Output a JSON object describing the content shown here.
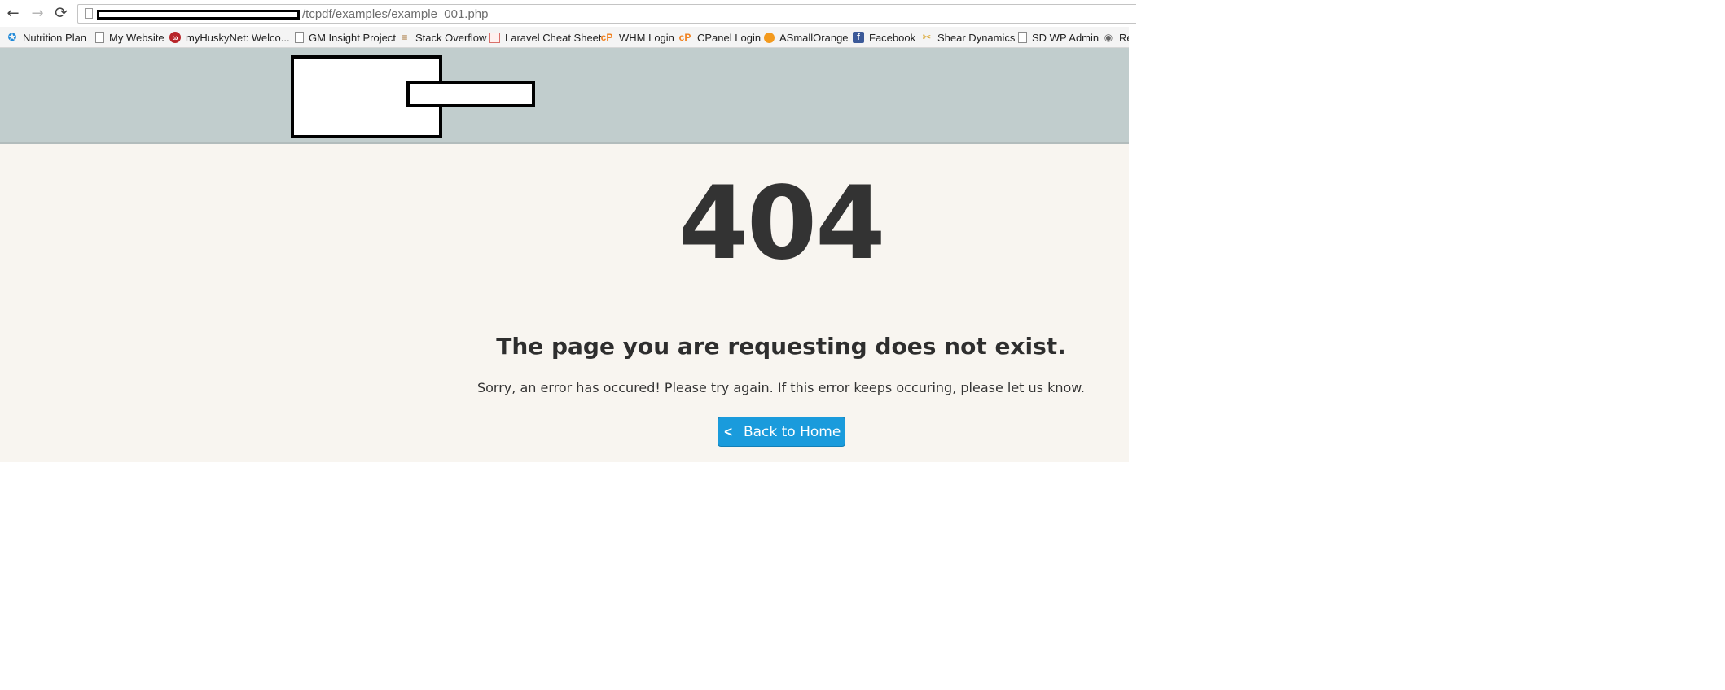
{
  "browser": {
    "url_visible_path": "/tcpdf/examples/example_001.php",
    "nav": {
      "back_icon": "←",
      "forward_icon": "→",
      "reload_icon": "⟳"
    }
  },
  "bookmarks": [
    {
      "label": "Nutrition Plan",
      "icon": "blue-bird-icon",
      "glyph": "✪"
    },
    {
      "label": "My Website",
      "icon": "page-icon",
      "glyph": ""
    },
    {
      "label": "myHuskyNet: Welco...",
      "icon": "husky-icon",
      "glyph": "ω"
    },
    {
      "label": "GM Insight Project",
      "icon": "page-icon",
      "glyph": ""
    },
    {
      "label": "Stack Overflow",
      "icon": "stackoverflow-icon",
      "glyph": "≡"
    },
    {
      "label": "Laravel Cheat Sheet",
      "icon": "laravel-icon",
      "glyph": ""
    },
    {
      "label": "WHM Login",
      "icon": "cpanel-icon",
      "glyph": "cP"
    },
    {
      "label": "CPanel Login",
      "icon": "cpanel-icon",
      "glyph": "cP"
    },
    {
      "label": "ASmallOrange",
      "icon": "orange-icon",
      "glyph": ""
    },
    {
      "label": "Facebook",
      "icon": "facebook-icon",
      "glyph": "f"
    },
    {
      "label": "Shear Dynamics",
      "icon": "shear-icon",
      "glyph": "✂"
    },
    {
      "label": "SD WP Admin",
      "icon": "page-icon",
      "glyph": ""
    },
    {
      "label": "Re",
      "icon": "reddit-icon",
      "glyph": "◉"
    }
  ],
  "main": {
    "code": "404",
    "title": "The page you are requesting does not exist.",
    "message": "Sorry, an error has occured! Please try again. If this error keeps occuring, please let us know.",
    "button_icon": "<",
    "button_label": "Back to Home"
  },
  "colors": {
    "header_bg": "#c1cdcd",
    "main_bg": "#f8f5f0",
    "button_bg": "#1a9bdc",
    "text": "#333333"
  }
}
